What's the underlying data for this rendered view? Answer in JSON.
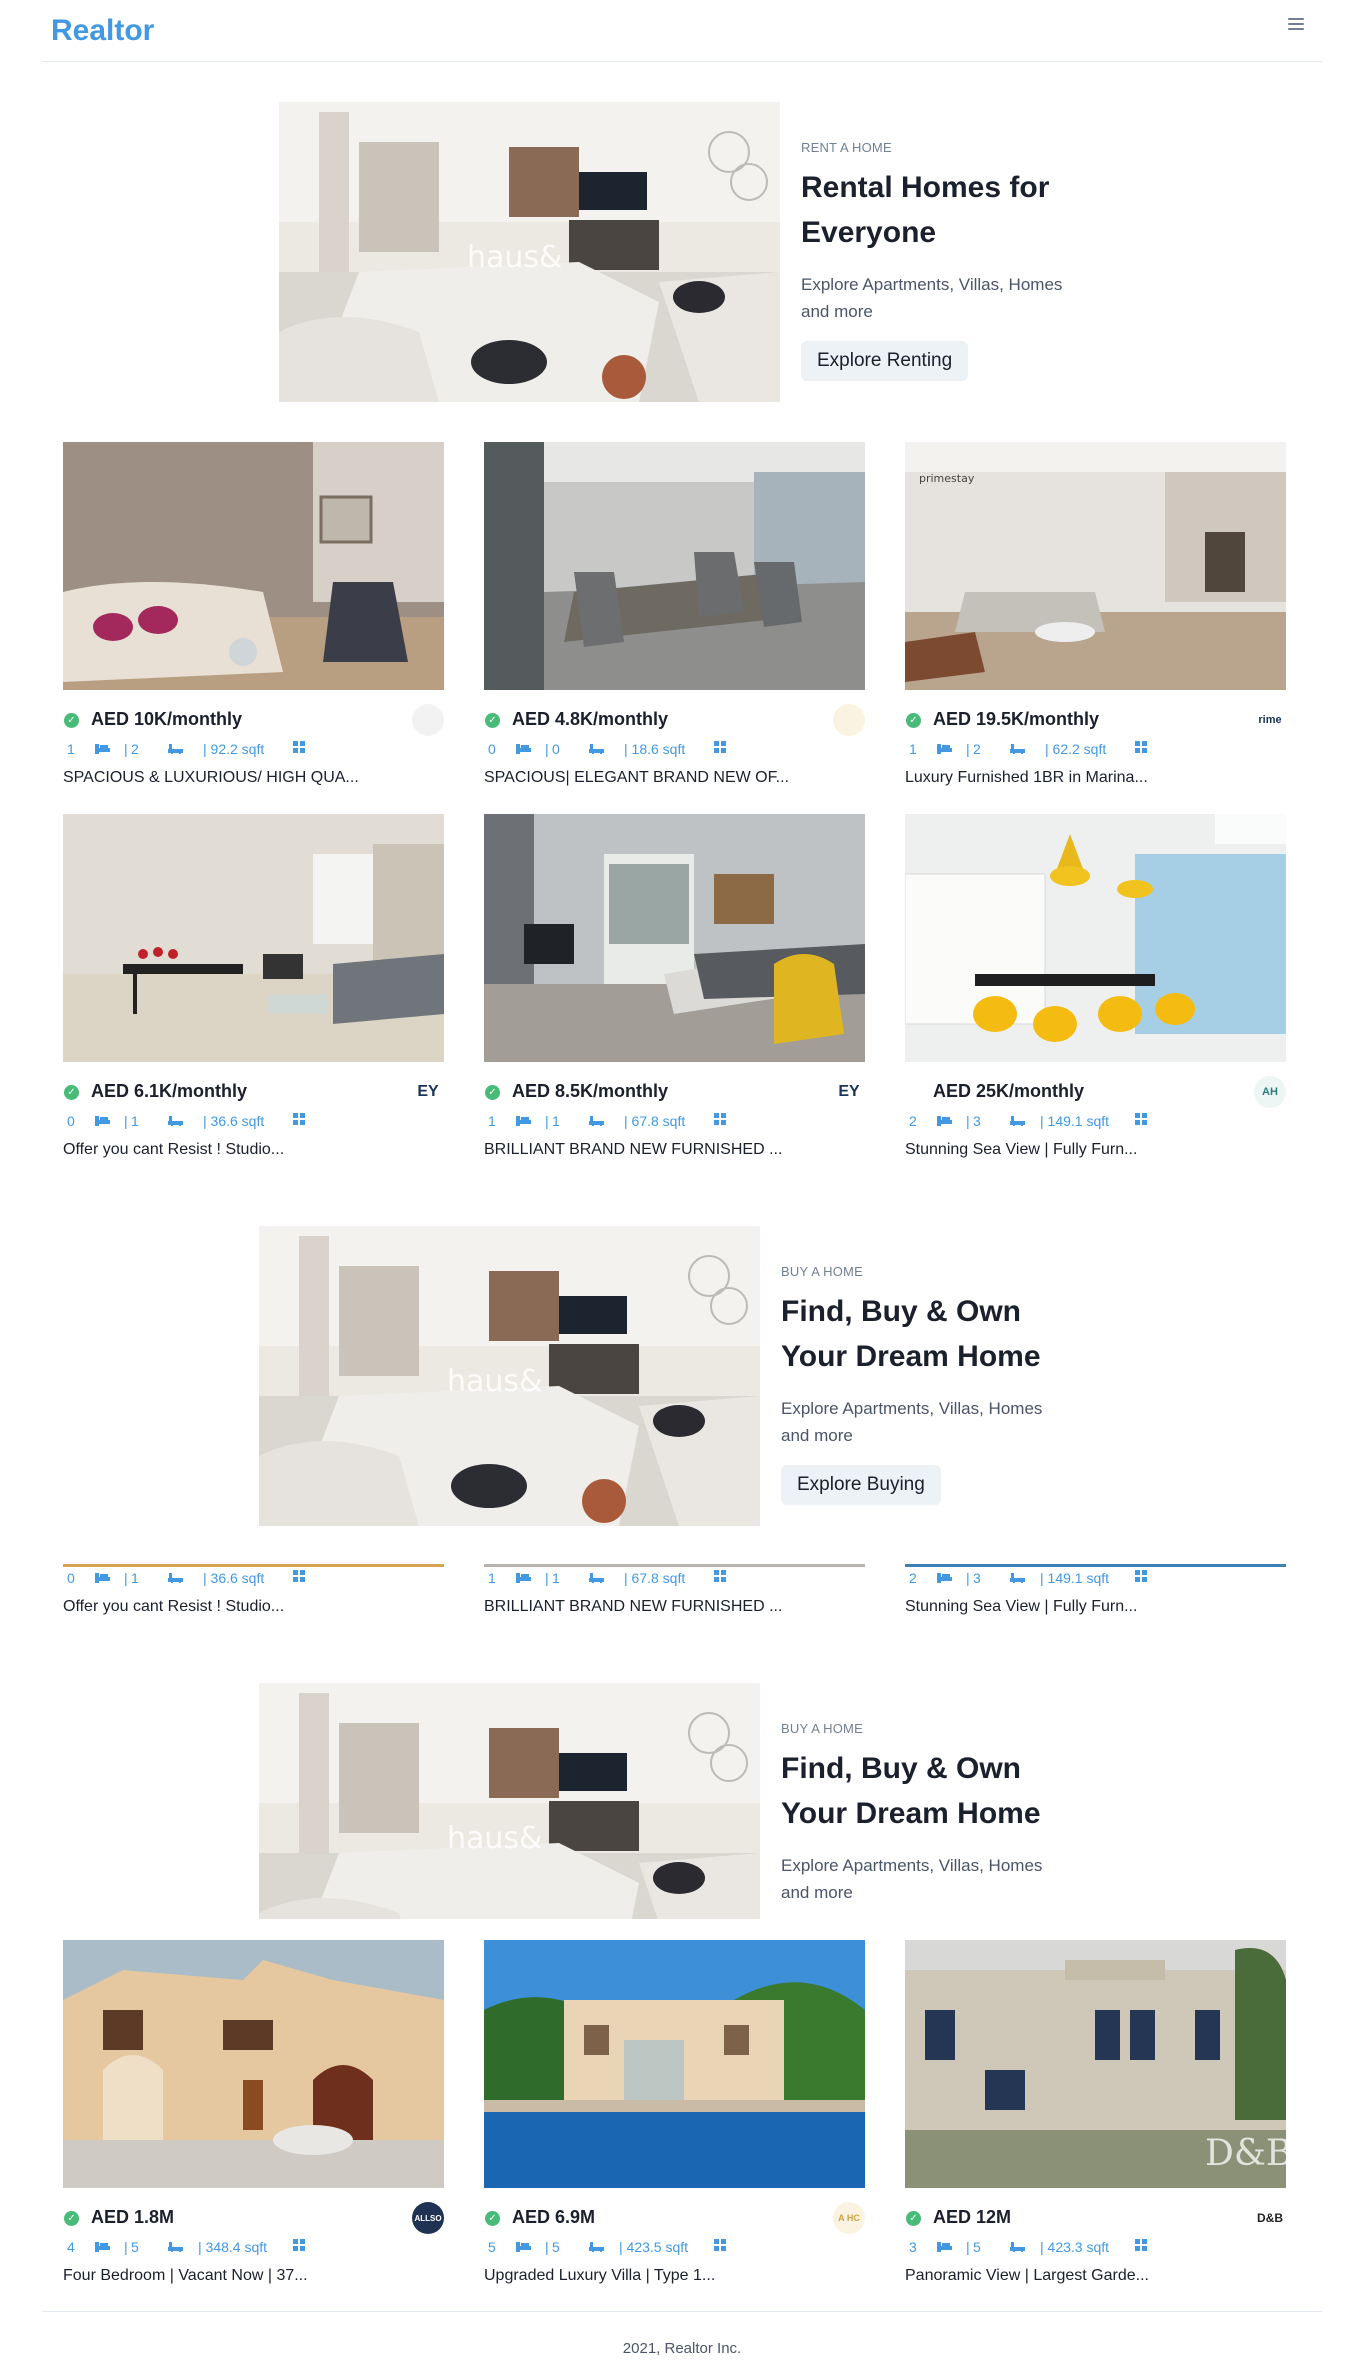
{
  "nav": {
    "brand": "Realtor",
    "menu_icon": "hamburger-icon"
  },
  "banners": [
    {
      "eyebrow": "RENT A HOME",
      "title": "Rental Homes for Everyone",
      "desc": "Explore Apartments, Villas, Homes and more",
      "button": "Explore Renting"
    },
    {
      "eyebrow": "BUY A HOME",
      "title": "Find, Buy & Own Your Dream Home",
      "desc": "Explore Apartments, Villas, Homes and more",
      "button": "Explore Buying"
    },
    {
      "eyebrow": "BUY A HOME",
      "title": "Find, Buy & Own Your Dream Home",
      "desc": "Explore Apartments, Villas, Homes and more"
    }
  ],
  "rent_cards": [
    {
      "price": "AED 10K/monthly",
      "rooms": "1",
      "baths": "2",
      "area": "| 92.2 sqft",
      "title": "SPACIOUS & LUXURIOUS/ HIGH QUA...",
      "agency": "",
      "verified": true
    },
    {
      "price": "AED 4.8K/monthly",
      "rooms": "0",
      "baths": "0",
      "area": "| 18.6 sqft",
      "title": "SPACIOUS| ELEGANT BRAND NEW OF...",
      "agency": "",
      "verified": true
    },
    {
      "price": "AED 19.5K/monthly",
      "rooms": "1",
      "baths": "2",
      "area": "| 62.2 sqft",
      "title": "Luxury Furnished 1BR in Marina...",
      "agency": "rime",
      "verified": true
    },
    {
      "price": "AED 6.1K/monthly",
      "rooms": "0",
      "baths": "1",
      "area": "| 36.6 sqft",
      "title": "Offer you cant Resist ! Studio...",
      "agency": "EY",
      "verified": true
    },
    {
      "price": "AED 8.5K/monthly",
      "rooms": "1",
      "baths": "1",
      "area": "| 67.8 sqft",
      "title": "BRILLIANT BRAND NEW FURNISHED ...",
      "agency": "EY",
      "verified": true
    },
    {
      "price": "AED 25K/monthly",
      "rooms": "2",
      "baths": "3",
      "area": "| 149.1 sqft",
      "title": "Stunning Sea View | Fully Furn...",
      "agency": "AH",
      "verified": false
    }
  ],
  "partial_cards": [
    {
      "rooms": "0",
      "baths": "1",
      "area": "| 36.6 sqft",
      "title": "Offer you cant Resist ! Studio..."
    },
    {
      "rooms": "1",
      "baths": "1",
      "area": "| 67.8 sqft",
      "title": "BRILLIANT BRAND NEW FURNISHED ..."
    },
    {
      "rooms": "2",
      "baths": "3",
      "area": "| 149.1 sqft",
      "title": "Stunning Sea View | Fully Furn..."
    }
  ],
  "buy_cards": [
    {
      "price": "AED 1.8M",
      "rooms": "4",
      "baths": "5",
      "area": "| 348.4 sqft",
      "title": "Four Bedroom | Vacant Now | 37...",
      "agency": "ALLSO",
      "verified": true
    },
    {
      "price": "AED 6.9M",
      "rooms": "5",
      "baths": "5",
      "area": "| 423.5 sqft",
      "title": "Upgraded Luxury Villa | Type 1...",
      "agency": "A HC",
      "verified": true
    },
    {
      "price": "AED 12M",
      "rooms": "3",
      "baths": "5",
      "area": "| 423.3 sqft",
      "title": "Panoramic View | Largest Garde...",
      "agency": "D&B",
      "verified": true
    }
  ],
  "image_overlays": {
    "banner_watermark": "haus&",
    "card3_logo": "primestay",
    "villa3_watermark": "D&B"
  },
  "footer": {
    "text": "2021, Realtor Inc."
  },
  "colors": {
    "brand": "#4299e1",
    "verified": "#48bb78",
    "button_bg": "#edf2f7",
    "meta": "#4299e1"
  }
}
